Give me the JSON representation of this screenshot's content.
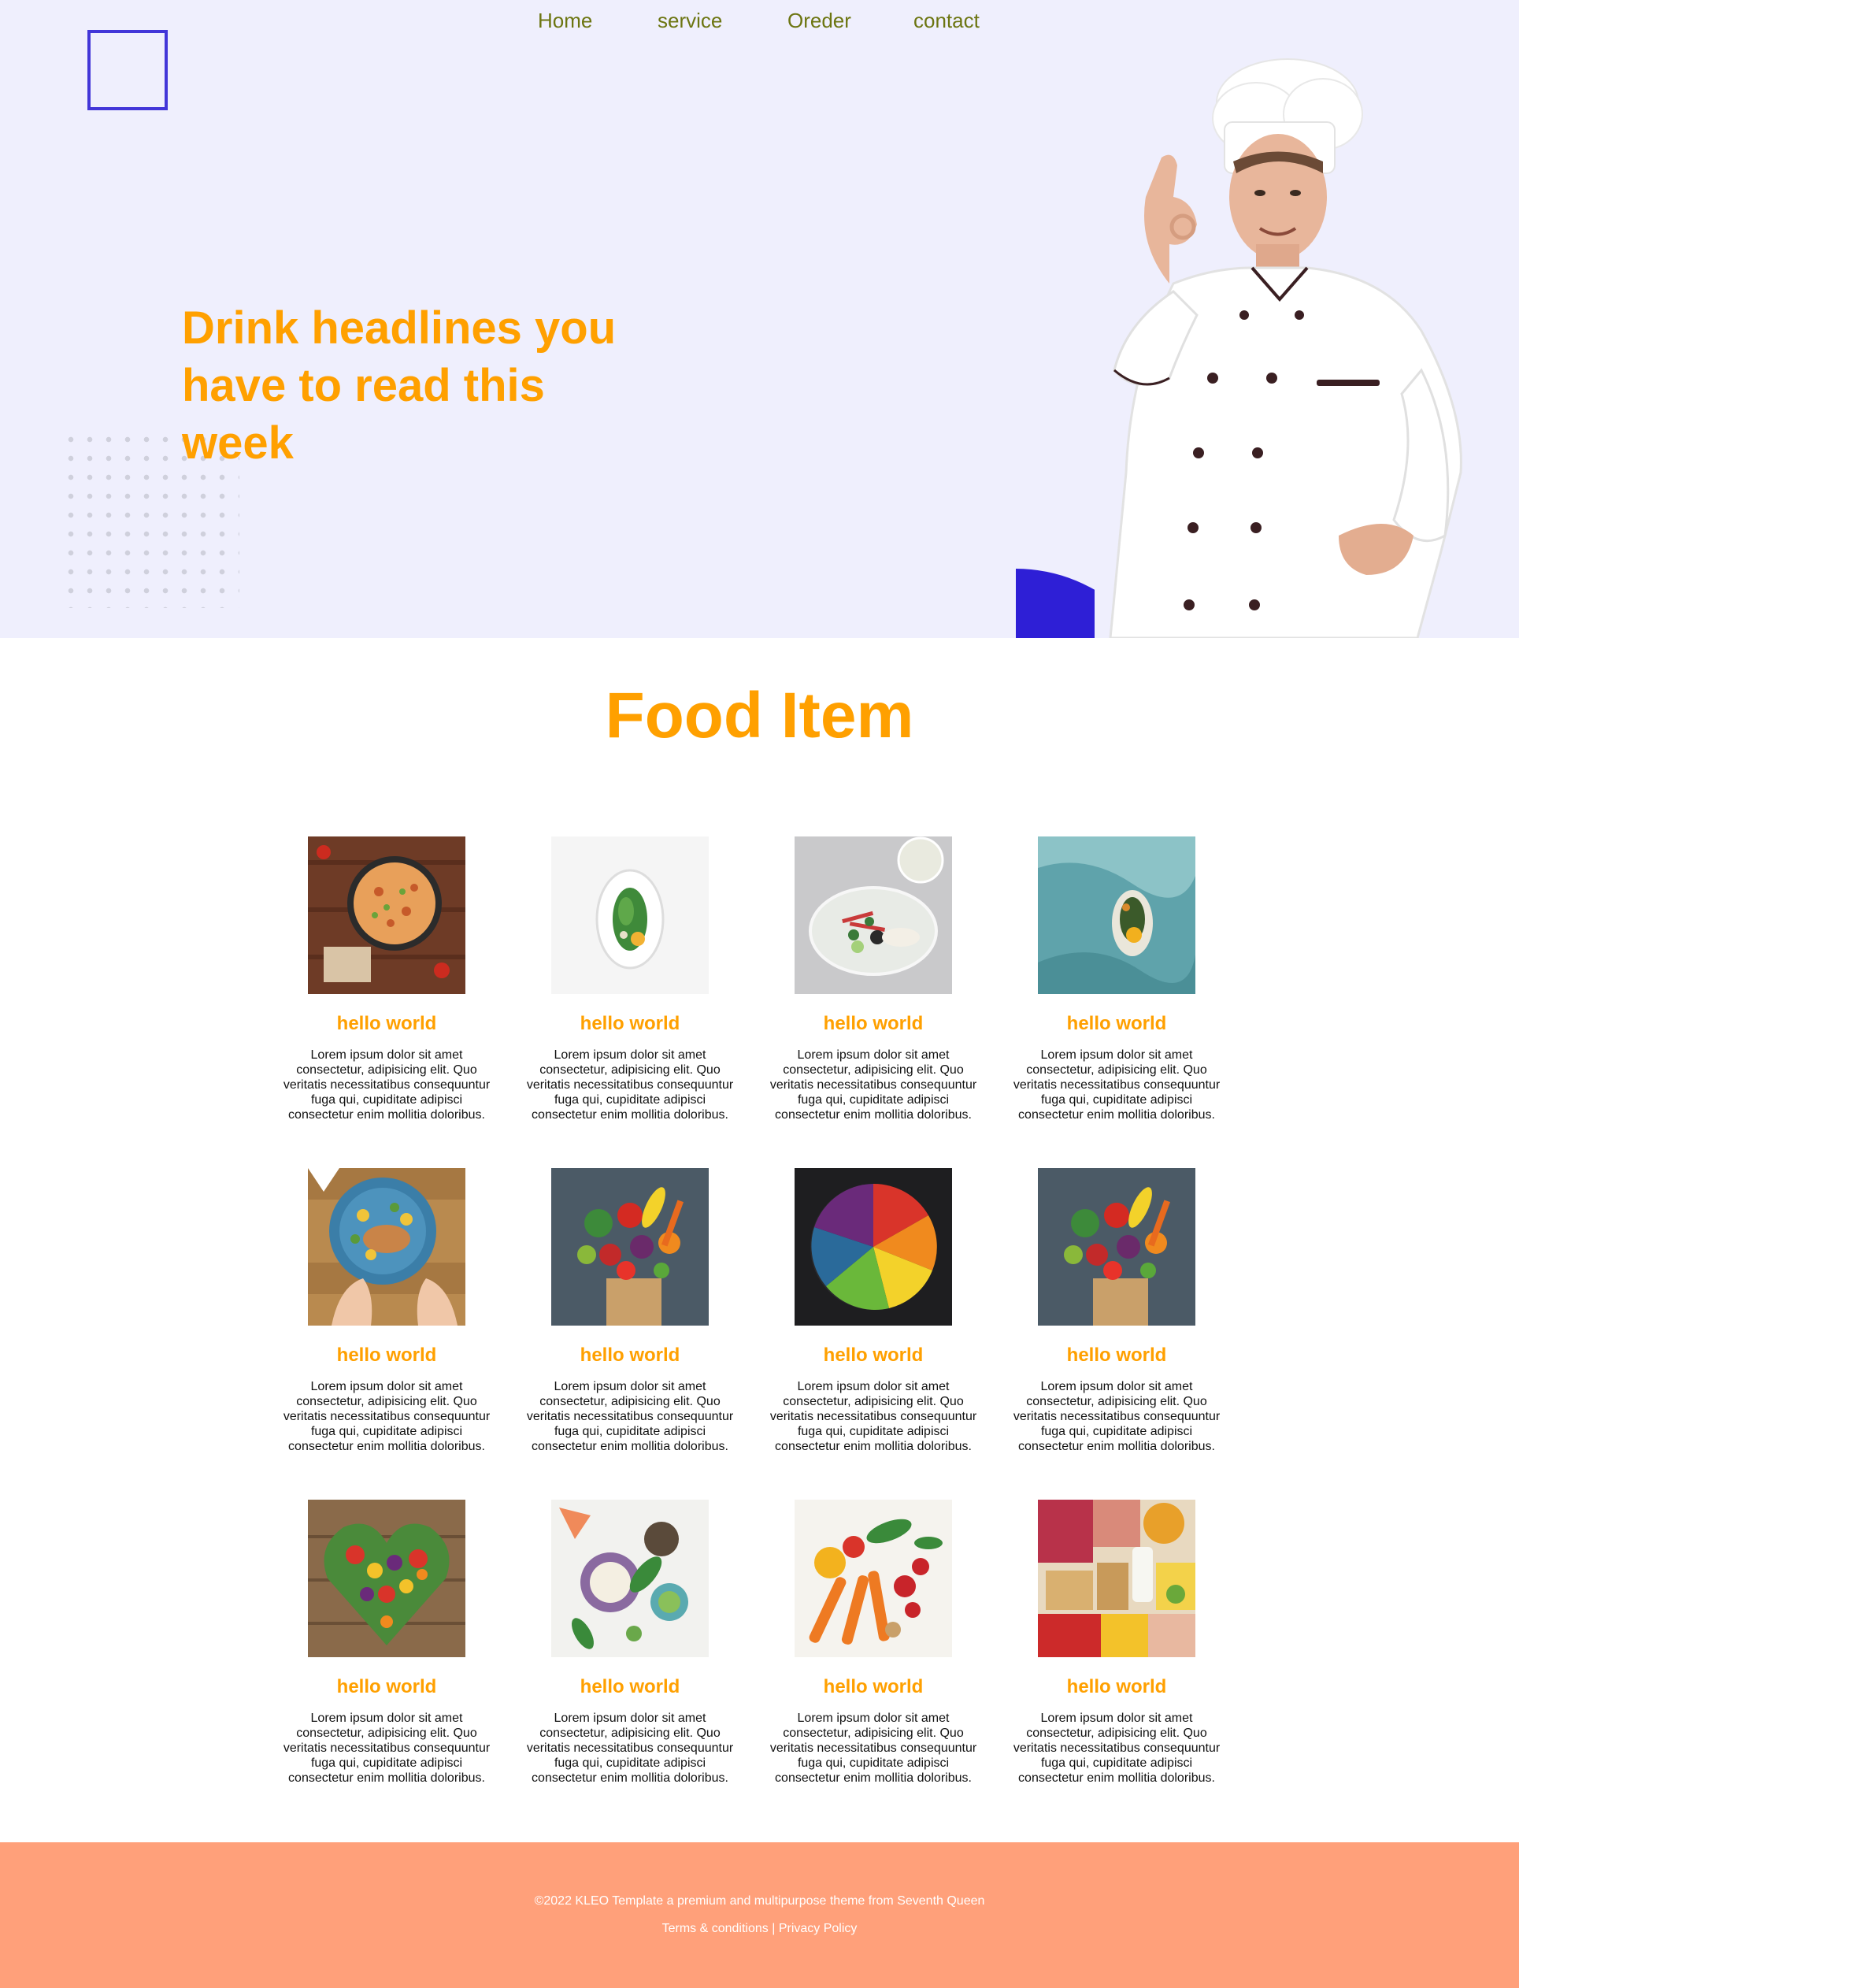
{
  "nav": {
    "items": [
      {
        "label": "Home"
      },
      {
        "label": "service"
      },
      {
        "label": "Oreder"
      },
      {
        "label": "contact"
      }
    ]
  },
  "hero": {
    "headline": "Drink headlines you have to read this week",
    "image_icon": "chef-illustration"
  },
  "food": {
    "title": "Food Item",
    "cards": [
      {
        "title": "hello world",
        "text": "Lorem ipsum dolor sit amet consectetur, adipisicing elit. Quo veritatis necessitatibus consequuntur fuga qui, cupiditate adipisci consectetur enim mollitia doloribus.",
        "image": "paella-pan"
      },
      {
        "title": "hello world",
        "text": "Lorem ipsum dolor sit amet consectetur, adipisicing elit. Quo veritatis necessitatibus consequuntur fuga qui, cupiditate adipisci consectetur enim mollitia doloribus.",
        "image": "plated-greens"
      },
      {
        "title": "hello world",
        "text": "Lorem ipsum dolor sit amet consectetur, adipisicing elit. Quo veritatis necessitatibus consequuntur fuga qui, cupiditate adipisci consectetur enim mollitia doloribus.",
        "image": "plated-salad"
      },
      {
        "title": "hello world",
        "text": "Lorem ipsum dolor sit amet consectetur, adipisicing elit. Quo veritatis necessitatibus consequuntur fuga qui, cupiditate adipisci consectetur enim mollitia doloribus.",
        "image": "bowl-on-blue"
      },
      {
        "title": "hello world",
        "text": "Lorem ipsum dolor sit amet consectetur, adipisicing elit. Quo veritatis necessitatibus consequuntur fuga qui, cupiditate adipisci consectetur enim mollitia doloribus.",
        "image": "blue-plate-dinner"
      },
      {
        "title": "hello world",
        "text": "Lorem ipsum dolor sit amet consectetur, adipisicing elit. Quo veritatis necessitatibus consequuntur fuga qui, cupiditate adipisci consectetur enim mollitia doloribus.",
        "image": "grocery-bag"
      },
      {
        "title": "hello world",
        "text": "Lorem ipsum dolor sit amet consectetur, adipisicing elit. Quo veritatis necessitatibus consequuntur fuga qui, cupiditate adipisci consectetur enim mollitia doloribus.",
        "image": "rainbow-produce"
      },
      {
        "title": "hello world",
        "text": "Lorem ipsum dolor sit amet consectetur, adipisicing elit. Quo veritatis necessitatibus consequuntur fuga qui, cupiditate adipisci consectetur enim mollitia doloribus.",
        "image": "grocery-bag"
      },
      {
        "title": "hello world",
        "text": "Lorem ipsum dolor sit amet consectetur, adipisicing elit. Quo veritatis necessitatibus consequuntur fuga qui, cupiditate adipisci consectetur enim mollitia doloribus.",
        "image": "veggie-heart"
      },
      {
        "title": "hello world",
        "text": "Lorem ipsum dolor sit amet consectetur, adipisicing elit. Quo veritatis necessitatibus consequuntur fuga qui, cupiditate adipisci consectetur enim mollitia doloribus.",
        "image": "ingredient-bowls"
      },
      {
        "title": "hello world",
        "text": "Lorem ipsum dolor sit amet consectetur, adipisicing elit. Quo veritatis necessitatibus consequuntur fuga qui, cupiditate adipisci consectetur enim mollitia doloribus.",
        "image": "carrots-tomatoes"
      },
      {
        "title": "hello world",
        "text": "Lorem ipsum dolor sit amet consectetur, adipisicing elit. Quo veritatis necessitatibus consequuntur fuga qui, cupiditate adipisci consectetur enim mollitia doloribus.",
        "image": "meat-dairy-produce"
      }
    ]
  },
  "footer": {
    "copyright": "©2022 KLEO Template a premium and multipurpose theme from Seventh Queen",
    "terms": "Terms & conditions",
    "separator": " | ",
    "privacy": "Privacy Policy"
  },
  "colors": {
    "accent": "#ffa000",
    "nav_text": "#6c7511",
    "hero_bg": "#efeffd",
    "brand_blue": "#2e1fd6",
    "footer_bg": "#ffa07a"
  }
}
